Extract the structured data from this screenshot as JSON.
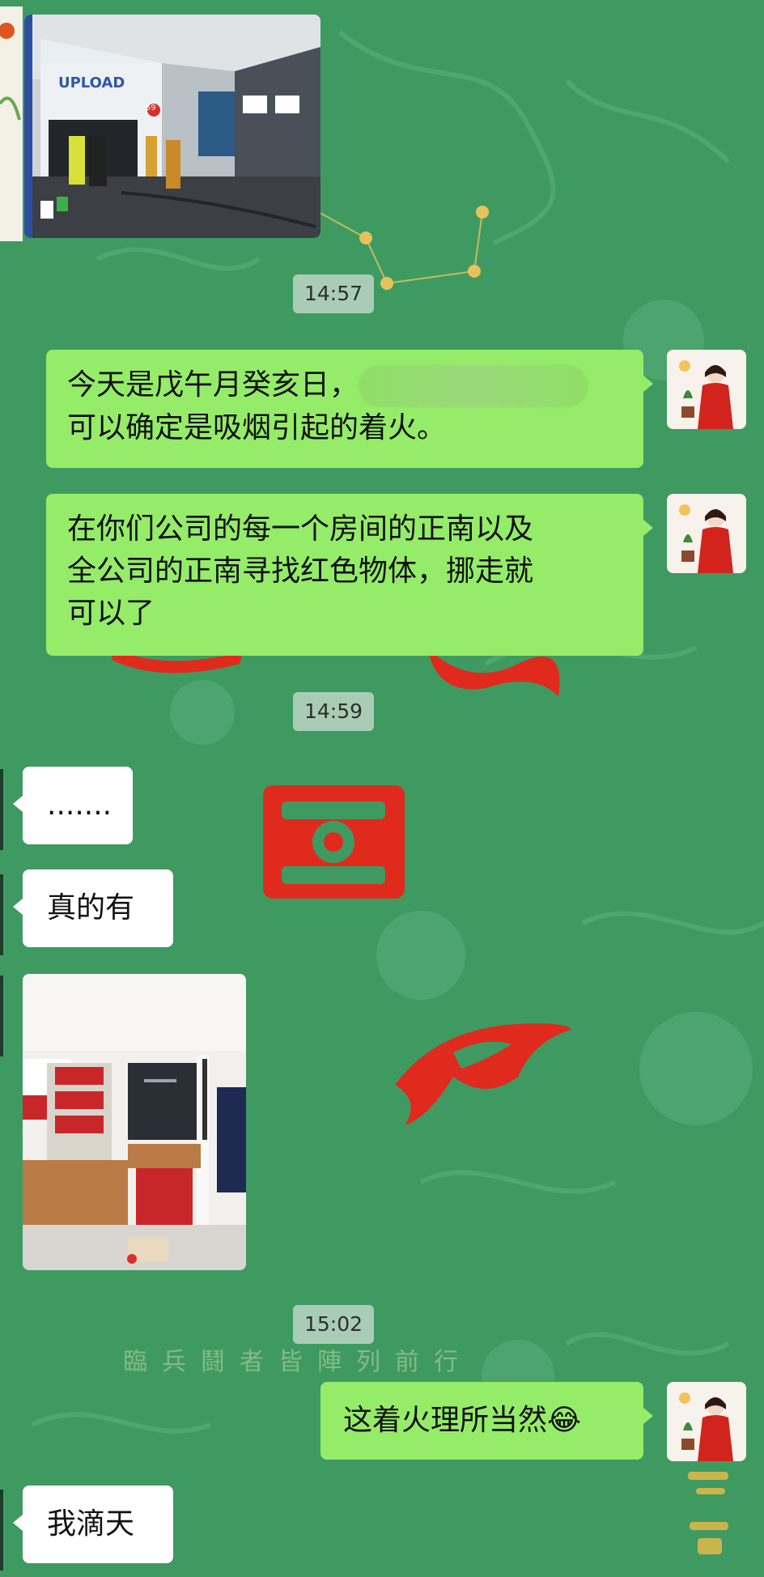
{
  "messages": {
    "timestamps": [
      "14:57",
      "14:59",
      "15:02"
    ],
    "sent_1": {
      "line1": "今天是戊午月癸亥日，",
      "line2": "可以确定是吸烟引起的着火。"
    },
    "sent_2": {
      "line1": "在你们公司的每一个房间的正南以及",
      "line2": "全公司的正南寻找红色物体，挪走就",
      "line3": "可以了"
    },
    "received_1": ".......",
    "received_2": "真的有",
    "sent_3": "这着火理所当然😂",
    "received_3": "我滴天"
  },
  "photo_1": {
    "sign_text": "UPLOAD",
    "sign_badge": "59"
  },
  "background": {
    "big_characters": [
      "懸",
      "圖",
      "令"
    ],
    "poem_text": "臨兵鬪者皆陣列前行",
    "corner_text": "無盡"
  },
  "colors": {
    "background": "#3f9a62",
    "sent_bubble": "#95ec69",
    "received_bubble": "#ffffff",
    "timestamp_bg": "#cedcd2",
    "seal_red": "#e02a1e"
  }
}
